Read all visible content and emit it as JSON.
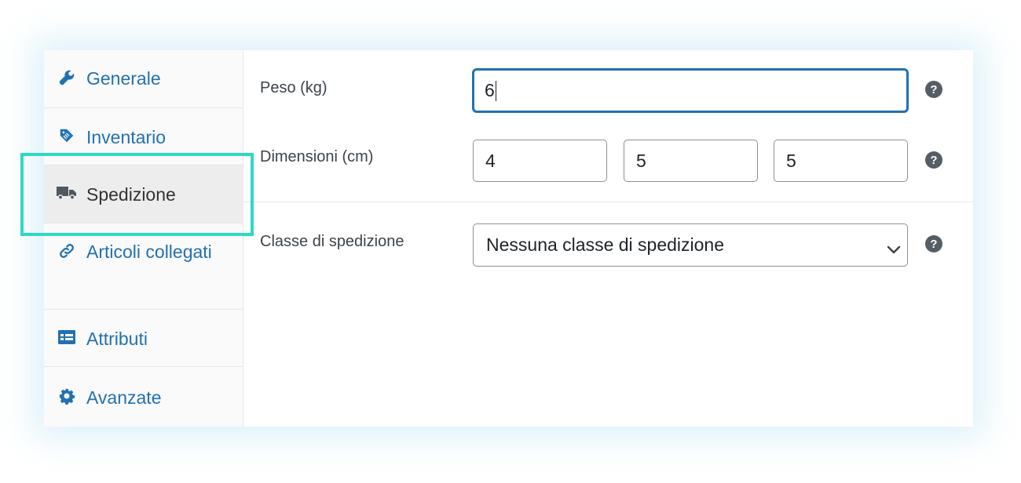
{
  "sidebar": {
    "items": [
      {
        "label": "Generale",
        "icon": "wrench-icon"
      },
      {
        "label": "Inventario",
        "icon": "tag-icon"
      },
      {
        "label": "Spedizione",
        "icon": "truck-icon",
        "active": true
      },
      {
        "label": "Articoli collegati",
        "icon": "link-icon"
      },
      {
        "label": "Attributi",
        "icon": "list-icon"
      },
      {
        "label": "Avanzate",
        "icon": "gear-icon"
      }
    ]
  },
  "shipping": {
    "weight": {
      "label": "Peso (kg)",
      "value": "6"
    },
    "dimensions": {
      "label": "Dimensioni (cm)",
      "length": "4",
      "width": "5",
      "height": "5"
    },
    "shipping_class": {
      "label": "Classe di spedizione",
      "selected": "Nessuna classe di spedizione"
    },
    "help_symbol": "?"
  },
  "colors": {
    "link": "#2271b1",
    "highlight": "#2ed9c3",
    "active_bg": "#ededed"
  }
}
